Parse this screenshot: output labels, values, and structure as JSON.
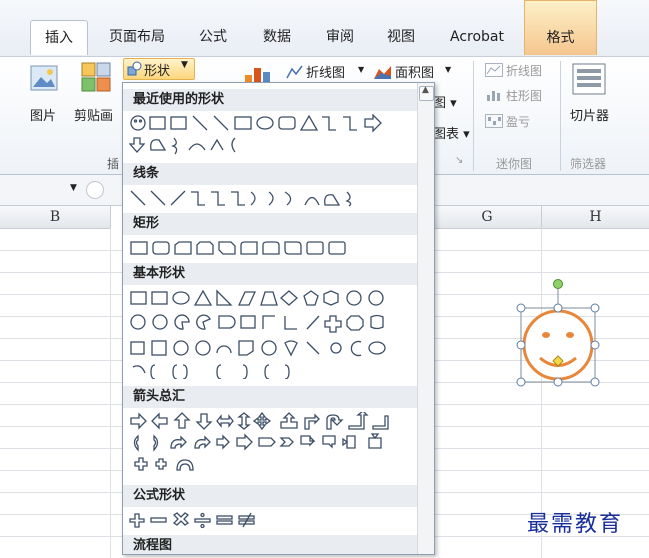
{
  "ribbon": {
    "tabs": [
      {
        "label": "插入",
        "active": true
      },
      {
        "label": "页面布局"
      },
      {
        "label": "公式"
      },
      {
        "label": "数据"
      },
      {
        "label": "审阅"
      },
      {
        "label": "视图"
      },
      {
        "label": "Acrobat"
      },
      {
        "label": "格式",
        "contextual": true
      }
    ],
    "picture_label": "图片",
    "clipart_label": "剪贴画",
    "shapes_button": "形状",
    "insert_group_partial": "插",
    "line_chart": "折线图",
    "area_chart": "面积图",
    "chart_partial": "图表",
    "sparkline_line": "折线图",
    "sparkline_column": "柱形图",
    "sparkline_winloss": "盈亏",
    "sparkline_group": "迷你图",
    "slicer_label": "切片器",
    "filter_group": "筛选器"
  },
  "sheet": {
    "columns": [
      "B",
      "G",
      "H"
    ]
  },
  "shapes_panel": {
    "sections": [
      "最近使用的形状",
      "线条",
      "矩形",
      "基本形状",
      "箭头总汇",
      "公式形状",
      "流程图"
    ]
  },
  "watermark": "最需教育",
  "colors": {
    "accent": "#1f4e9c",
    "smiley_stroke": "#e8863a",
    "format_tab": "#f5c68e"
  }
}
